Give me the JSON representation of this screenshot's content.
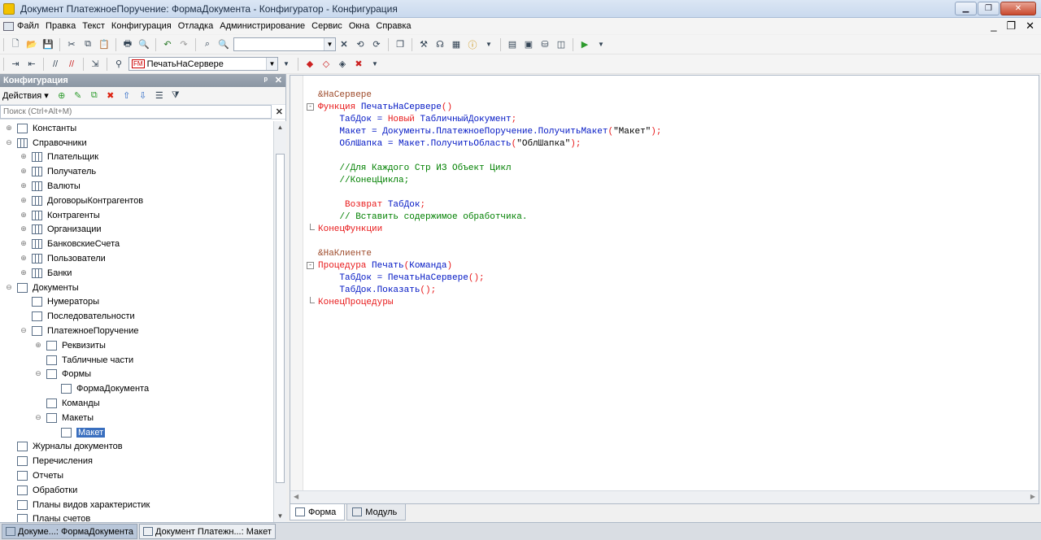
{
  "window": {
    "title": "Документ ПлатежноеПоручение: ФормаДокумента - Конфигуратор - Конфигурация",
    "icons": {
      "minimize": "minimize-icon",
      "maximize": "maximize-icon",
      "close": "close-icon"
    }
  },
  "menu": [
    "Файл",
    "Правка",
    "Текст",
    "Конфигурация",
    "Отладка",
    "Администрирование",
    "Сервис",
    "Окна",
    "Справка"
  ],
  "toolbar2": {
    "search_value": ""
  },
  "toolbar3": {
    "procedure_combo": "ПечатьНаСервере",
    "combo_badge": "FM"
  },
  "left_panel": {
    "title": "Конфигурация",
    "actions_label": "Действия",
    "search_placeholder": "Поиск (Ctrl+Alt+M)",
    "tree": [
      {
        "label": "Константы",
        "level": 0,
        "expander": "+",
        "icon": "constants-icon"
      },
      {
        "label": "Справочники",
        "level": 0,
        "expander": "-",
        "icon": "catalog-icon"
      },
      {
        "label": "Плательщик",
        "level": 1,
        "expander": "+",
        "icon": "catalog-icon"
      },
      {
        "label": "Получатель",
        "level": 1,
        "expander": "+",
        "icon": "catalog-icon"
      },
      {
        "label": "Валюты",
        "level": 1,
        "expander": "+",
        "icon": "catalog-icon"
      },
      {
        "label": "ДоговорыКонтрагентов",
        "level": 1,
        "expander": "+",
        "icon": "catalog-icon"
      },
      {
        "label": "Контрагенты",
        "level": 1,
        "expander": "+",
        "icon": "catalog-icon"
      },
      {
        "label": "Организации",
        "level": 1,
        "expander": "+",
        "icon": "catalog-icon"
      },
      {
        "label": "БанковскиеСчета",
        "level": 1,
        "expander": "+",
        "icon": "catalog-icon"
      },
      {
        "label": "Пользователи",
        "level": 1,
        "expander": "+",
        "icon": "catalog-icon"
      },
      {
        "label": "Банки",
        "level": 1,
        "expander": "+",
        "icon": "catalog-icon"
      },
      {
        "label": "Документы",
        "level": 0,
        "expander": "-",
        "icon": "document-icon"
      },
      {
        "label": "Нумераторы",
        "level": 1,
        "expander": "",
        "icon": "numerator-icon"
      },
      {
        "label": "Последовательности",
        "level": 1,
        "expander": "",
        "icon": "sequence-icon"
      },
      {
        "label": "ПлатежноеПоручение",
        "level": 1,
        "expander": "-",
        "icon": "document-icon"
      },
      {
        "label": "Реквизиты",
        "level": 2,
        "expander": "+",
        "icon": "attribute-icon"
      },
      {
        "label": "Табличные части",
        "level": 2,
        "expander": "",
        "icon": "table-icon"
      },
      {
        "label": "Формы",
        "level": 2,
        "expander": "-",
        "icon": "form-icon"
      },
      {
        "label": "ФормаДокумента",
        "level": 3,
        "expander": "",
        "icon": "form-icon"
      },
      {
        "label": "Команды",
        "level": 2,
        "expander": "",
        "icon": "command-icon"
      },
      {
        "label": "Макеты",
        "level": 2,
        "expander": "-",
        "icon": "template-icon"
      },
      {
        "label": "Макет",
        "level": 3,
        "expander": "",
        "icon": "template-icon",
        "selected": true
      },
      {
        "label": "Журналы документов",
        "level": 0,
        "expander": "",
        "icon": "journal-icon"
      },
      {
        "label": "Перечисления",
        "level": 0,
        "expander": "",
        "icon": "enum-icon"
      },
      {
        "label": "Отчеты",
        "level": 0,
        "expander": "",
        "icon": "report-icon"
      },
      {
        "label": "Обработки",
        "level": 0,
        "expander": "",
        "icon": "processing-icon"
      },
      {
        "label": "Планы видов характеристик",
        "level": 0,
        "expander": "",
        "icon": "chart-of-characteristics-icon"
      },
      {
        "label": "Планы счетов",
        "level": 0,
        "expander": "",
        "icon": "chart-of-accounts-icon"
      }
    ]
  },
  "code": [
    [
      {
        "t": "&НаСервере",
        "c": "pr"
      }
    ],
    [
      {
        "t": "Функция ",
        "c": "kw"
      },
      {
        "t": "ПечатьНаСервере",
        "c": "id"
      },
      {
        "t": "()",
        "c": "pu"
      }
    ],
    [
      {
        "t": "    ТабДок = ",
        "c": "id"
      },
      {
        "t": "Новый ",
        "c": "kw"
      },
      {
        "t": "ТабличныйДокумент",
        "c": "id"
      },
      {
        "t": ";",
        "c": "pu"
      }
    ],
    [
      {
        "t": "    Макет = Документы.ПлатежноеПоручение.ПолучитьМакет",
        "c": "id"
      },
      {
        "t": "(",
        "c": "pu"
      },
      {
        "t": "\"Макет\"",
        "c": "str"
      },
      {
        "t": ");",
        "c": "pu"
      }
    ],
    [
      {
        "t": "    ОблШапка = Макет.ПолучитьОбласть",
        "c": "id"
      },
      {
        "t": "(",
        "c": "pu"
      },
      {
        "t": "\"ОблШапка\"",
        "c": "str"
      },
      {
        "t": ");",
        "c": "pu"
      }
    ],
    [
      {
        "t": "",
        "c": "id"
      }
    ],
    [
      {
        "t": "    //Для Каждого Стр ИЗ Объект Цикл",
        "c": "cm"
      }
    ],
    [
      {
        "t": "    //КонецЦикла;",
        "c": "cm"
      }
    ],
    [
      {
        "t": "",
        "c": "id"
      }
    ],
    [
      {
        "t": "     Возврат ",
        "c": "kw"
      },
      {
        "t": "ТабДок",
        "c": "id"
      },
      {
        "t": ";",
        "c": "pu"
      }
    ],
    [
      {
        "t": "    // Вставить содержимое обработчика.",
        "c": "cm"
      }
    ],
    [
      {
        "t": "КонецФункции",
        "c": "kw"
      }
    ],
    [
      {
        "t": "",
        "c": "id"
      }
    ],
    [
      {
        "t": "&НаКлиенте",
        "c": "pr"
      }
    ],
    [
      {
        "t": "Процедура ",
        "c": "kw"
      },
      {
        "t": "Печать",
        "c": "id"
      },
      {
        "t": "(",
        "c": "pu"
      },
      {
        "t": "Команда",
        "c": "id"
      },
      {
        "t": ")",
        "c": "pu"
      }
    ],
    [
      {
        "t": "    ТабДок = ПечатьНаСервере",
        "c": "id"
      },
      {
        "t": "();",
        "c": "pu"
      }
    ],
    [
      {
        "t": "    ТабДок.Показать",
        "c": "id"
      },
      {
        "t": "();",
        "c": "pu"
      }
    ],
    [
      {
        "t": "КонецПроцедуры",
        "c": "kw"
      }
    ]
  ],
  "editor_tabs": [
    {
      "label": "Форма",
      "active": true,
      "icon": "form-icon"
    },
    {
      "label": "Модуль",
      "active": false,
      "icon": "module-icon"
    }
  ],
  "taskbar": [
    {
      "label": "Докуме...: ФормаДокумента",
      "active": true,
      "icon": "form-icon"
    },
    {
      "label": "Документ Платежн...: Макет",
      "active": false,
      "icon": "template-icon"
    }
  ]
}
